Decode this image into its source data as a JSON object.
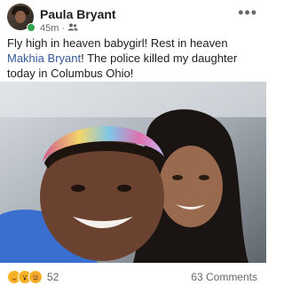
{
  "post": {
    "author": "Paula Bryant",
    "time": "45m",
    "privacy_icon": "friends-icon",
    "text_before": "Fly high in heaven babygirl! Rest in heaven ",
    "mention": "Makhia Bryant",
    "text_after": "! The police killed my daughter today in Columbus Ohio!",
    "online_status_color": "#31a24c",
    "mention_color": "#385898"
  },
  "footer": {
    "reaction_icons": [
      "care-emoji-icon",
      "wow-emoji-icon",
      "sad-emoji-icon"
    ],
    "reaction_count": "52",
    "comments": "63 Comments"
  }
}
